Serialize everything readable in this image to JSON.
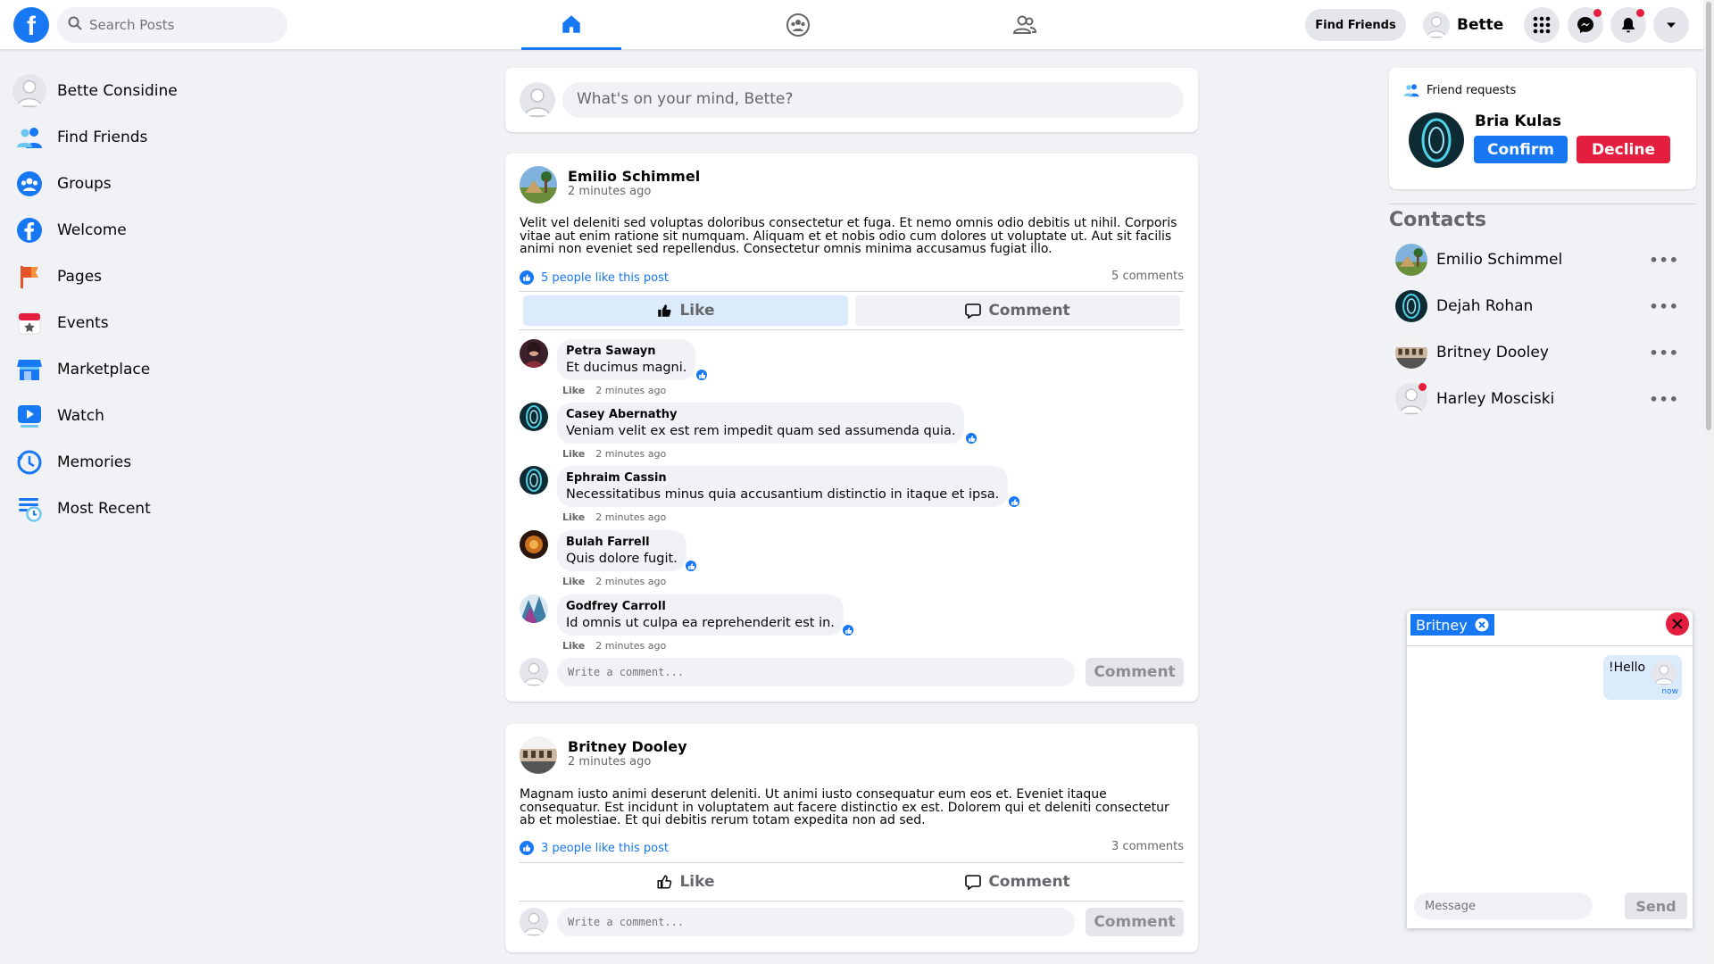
{
  "header": {
    "search_placeholder": "Search Posts",
    "find_friends": "Find Friends",
    "user_name": "Bette"
  },
  "sidebar": {
    "items": [
      {
        "label": "Bette Considine"
      },
      {
        "label": "Find Friends"
      },
      {
        "label": "Groups"
      },
      {
        "label": "Welcome"
      },
      {
        "label": "Pages"
      },
      {
        "label": "Events"
      },
      {
        "label": "Marketplace"
      },
      {
        "label": "Watch"
      },
      {
        "label": "Memories"
      },
      {
        "label": "Most Recent"
      }
    ]
  },
  "composer": {
    "placeholder": "What's on your mind, Bette?"
  },
  "posts": [
    {
      "author": "Emilio Schimmel",
      "time": "2 minutes ago",
      "text": "Velit vel deleniti sed voluptas doloribus consectetur et fuga. Et nemo omnis odio debitis ut nihil. Corporis vitae aut enim ratione sit numquam. Aliquam et et nobis odio cum dolores ut voluptate ut. Aut sit facilis animi non eveniet sed repellendus. Consectetur omnis minima accusamus fugiat illo.",
      "likes": "5 people like this post",
      "comments_count": "5 comments",
      "like_label": "Like",
      "comment_label": "Comment",
      "comments": [
        {
          "name": "Petra Sawayn",
          "text": "Et ducimus magni.",
          "like": "Like",
          "time": "2 minutes ago"
        },
        {
          "name": "Casey Abernathy",
          "text": "Veniam velit ex est rem impedit quam sed assumenda quia.",
          "like": "Like",
          "time": "2 minutes ago"
        },
        {
          "name": "Ephraim Cassin",
          "text": "Necessitatibus minus quia accusantium distinctio in itaque et ipsa.",
          "like": "Like",
          "time": "2 minutes ago"
        },
        {
          "name": "Bulah Farrell",
          "text": "Quis dolore fugit.",
          "like": "Like",
          "time": "2 minutes ago"
        },
        {
          "name": "Godfrey Carroll",
          "text": "Id omnis ut culpa ea reprehenderit est in.",
          "like": "Like",
          "time": "2 minutes ago"
        }
      ],
      "write_placeholder": "Write a comment...",
      "submit_label": "Comment"
    },
    {
      "author": "Britney Dooley",
      "time": "2 minutes ago",
      "text": "Magnam iusto animi deserunt deleniti. Ut animi iusto consequatur eum eos et. Eveniet itaque consequatur. Est incidunt in voluptatem aut facere distinctio ex est. Dolorem qui et deleniti consectetur ab et molestiae. Et qui debitis rerum totam expedita non ad sed.",
      "likes": "3 people like this post",
      "comments_count": "3 comments",
      "like_label": "Like",
      "comment_label": "Comment",
      "write_placeholder": "Write a comment...",
      "submit_label": "Comment"
    }
  ],
  "friend_requests": {
    "title": "Friend requests",
    "name": "Bria Kulas",
    "confirm": "Confirm",
    "decline": "Decline"
  },
  "contacts": {
    "title": "Contacts",
    "list": [
      {
        "name": "Emilio Schimmel",
        "more": "•••"
      },
      {
        "name": "Dejah Rohan",
        "more": "•••"
      },
      {
        "name": "Britney Dooley",
        "more": "•••"
      },
      {
        "name": "Harley Mosciski",
        "more": "•••"
      }
    ]
  },
  "chat": {
    "name": "Britney",
    "message": "!Hello",
    "message_time": "now",
    "placeholder": "Message",
    "send": "Send"
  },
  "colors": {
    "accent": "#1877f2",
    "danger": "#e41e3f",
    "background": "#f0f2f5"
  }
}
